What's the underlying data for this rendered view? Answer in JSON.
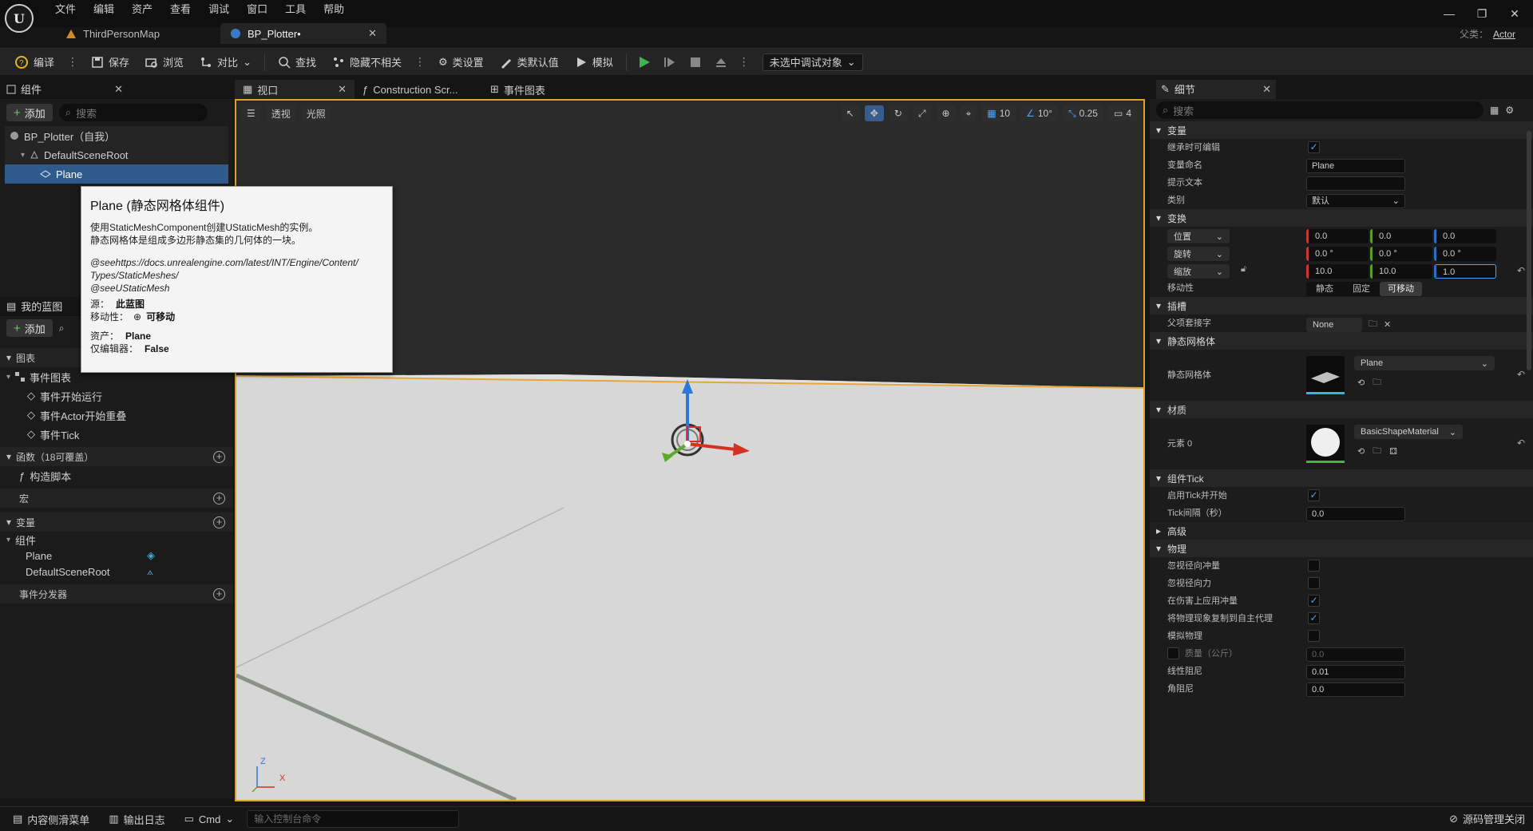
{
  "menu": [
    "文件",
    "编辑",
    "资产",
    "查看",
    "调试",
    "窗口",
    "工具",
    "帮助"
  ],
  "doc_tabs": {
    "thirdperson": "ThirdPersonMap",
    "bpplotter": "BP_Plotter•"
  },
  "parent_class": {
    "label": "父类：",
    "value": "Actor"
  },
  "toolbar": {
    "compile": "编译",
    "save": "保存",
    "browse": "浏览",
    "diff": "对比",
    "find": "查找",
    "hide_unrelated": "隐藏不相关",
    "class_settings": "类设置",
    "class_defaults": "类默认值",
    "simulate": "模拟",
    "debug_object": "未选中调试对象"
  },
  "components_panel": {
    "title": "组件",
    "add": "添加",
    "search_placeholder": "搜索",
    "tree": [
      {
        "label": "BP_Plotter（自我）"
      },
      {
        "label": "DefaultSceneRoot"
      },
      {
        "label": "Plane"
      }
    ]
  },
  "tooltip": {
    "title": "Plane (静态网格体组件)",
    "line1": "使用StaticMeshComponent创建UStaticMesh的实例。",
    "line2": "静态网格体是组成多边形静态集的几何体的一块。",
    "see1": "@seehttps://docs.unrealengine.com/latest/INT/Engine/Content/",
    "see2": "Types/StaticMeshes/",
    "see3": "@seeUStaticMesh",
    "source_label": "源：",
    "source_value": "此蓝图",
    "mobility_label": "移动性：",
    "mobility_value": "可移动",
    "asset_label": "资产：",
    "asset_value": "Plane",
    "editor_only_label": "仅编辑器：",
    "editor_only_value": "False"
  },
  "my_blueprint": {
    "title": "我的蓝图",
    "add": "添加",
    "graphs_section": "图表",
    "event_graph": "事件图表",
    "events": [
      "事件开始运行",
      "事件Actor开始重叠",
      "事件Tick"
    ],
    "functions_section": "函数（18可覆盖）",
    "construction": "构造脚本",
    "macros_section": "宏",
    "variables_section": "变量",
    "components_group": "组件",
    "variables": [
      "Plane",
      "DefaultSceneRoot"
    ],
    "dispatchers_section": "事件分发器"
  },
  "center_tabs": {
    "viewport": "视口",
    "construction": "Construction Scr...",
    "event_graph": "事件图表"
  },
  "viewport_toolbar": {
    "perspective": "透视",
    "lit": "光照",
    "grid": "10",
    "angle": "10°",
    "scale": "0.25",
    "camera": "4"
  },
  "axis": {
    "z": "Z",
    "x": "X"
  },
  "details": {
    "title": "细节",
    "search_placeholder": "搜索",
    "sec_variable": "变量",
    "instance_editable": "继承时可编辑",
    "var_name_label": "变量命名",
    "var_name_value": "Plane",
    "tooltip_label": "提示文本",
    "category_label": "类别",
    "category_value": "默认",
    "sec_transform": "变换",
    "location": "位置",
    "location_vals": [
      "0.0",
      "0.0",
      "0.0"
    ],
    "rotation": "旋转",
    "rotation_vals": [
      "0.0 °",
      "0.0 °",
      "0.0 °"
    ],
    "scale": "缩放",
    "scale_vals": [
      "10.0",
      "10.0",
      "1.0"
    ],
    "mobility_label": "移动性",
    "mobility_opts": [
      "静态",
      "固定",
      "可移动"
    ],
    "sec_sockets": "插槽",
    "parent_socket_label": "父项套接字",
    "parent_socket_value": "None",
    "sec_static_mesh": "静态网格体",
    "static_mesh_label": "静态网格体",
    "static_mesh_value": "Plane",
    "sec_materials": "材质",
    "element0_label": "元素 0",
    "element0_value": "BasicShapeMaterial",
    "sec_component_tick": "组件Tick",
    "start_tick_label": "启用Tick并开始",
    "tick_interval_label": "Tick间隔（秒）",
    "tick_interval_value": "0.0",
    "sec_advanced": "高级",
    "sec_physics": "物理",
    "ignore_radial_impulse": "忽视径向冲量",
    "ignore_radial_force": "忽视径向力",
    "apply_impulse_damage": "在伤害上应用冲量",
    "replicate_physics": "将物理现象复制到自主代理",
    "simulate_physics": "模拟物理",
    "mass_label": "质量（公斤）",
    "mass_value": "0.0",
    "linear_damping_label": "线性阻尼",
    "linear_damping_value": "0.01",
    "angular_damping_label": "角阻尼",
    "angular_damping_value": "0.0"
  },
  "statusbar": {
    "content_drawer": "内容侧滑菜单",
    "output_log": "输出日志",
    "cmd": "Cmd",
    "console_placeholder": "输入控制台命令",
    "source_control": "源码管理关闭"
  }
}
